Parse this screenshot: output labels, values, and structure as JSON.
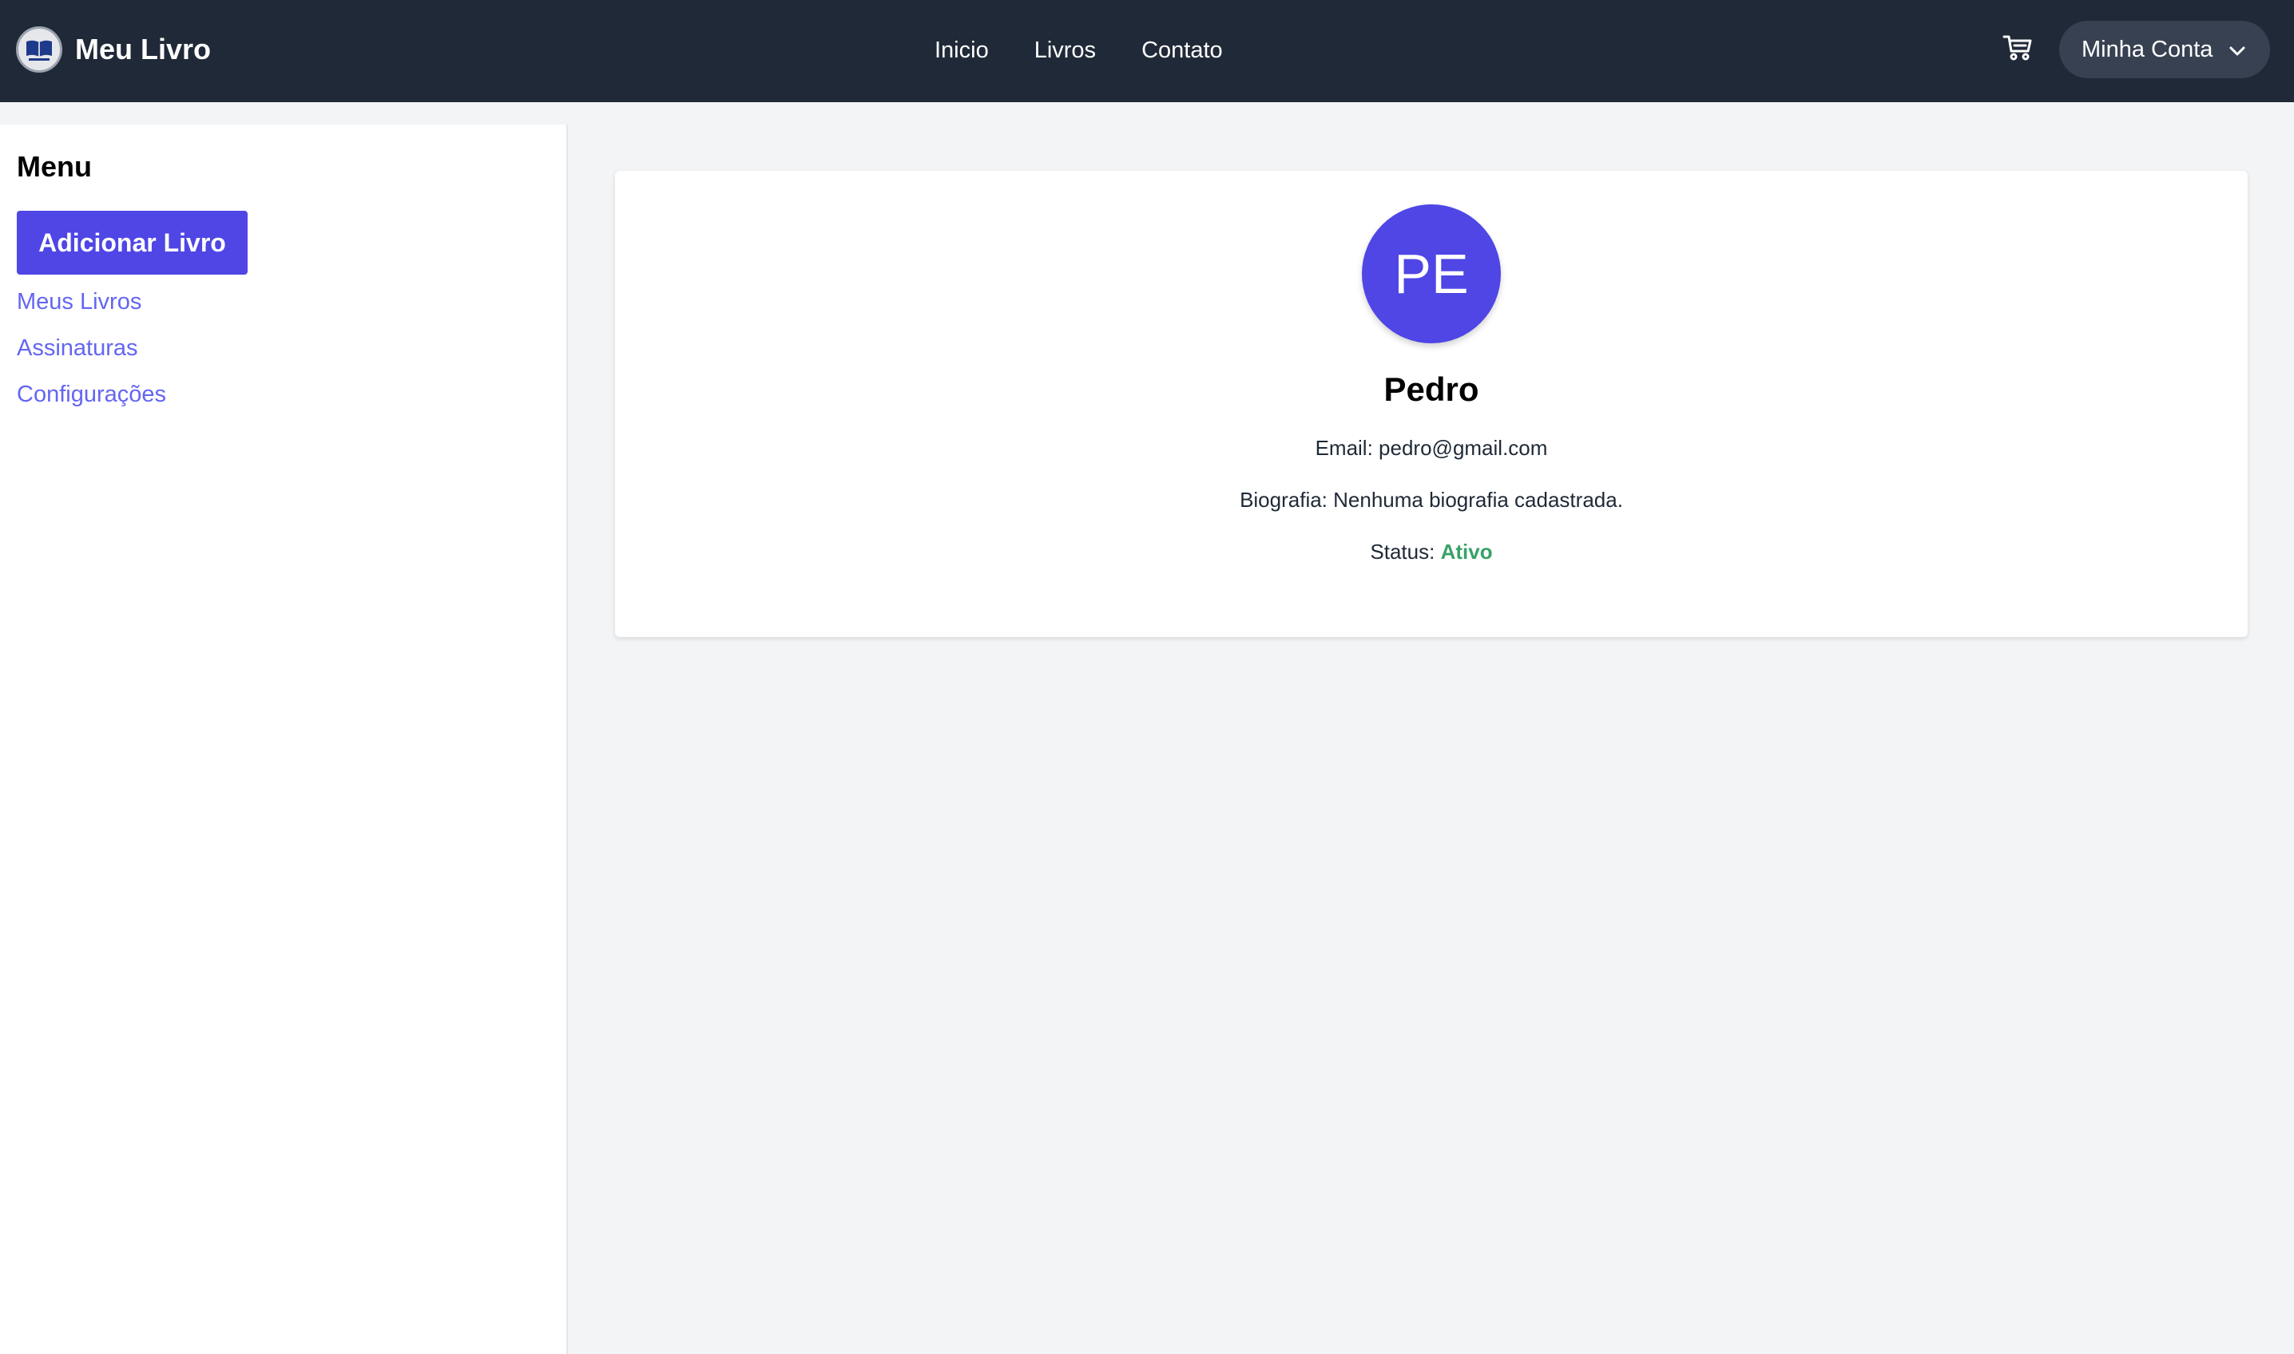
{
  "header": {
    "brand": "Meu Livro",
    "nav": [
      "Inicio",
      "Livros",
      "Contato"
    ],
    "cart_icon": "cart-icon",
    "account_label": "Minha Conta"
  },
  "sidebar": {
    "title": "Menu",
    "add_button": "Adicionar Livro",
    "links": [
      "Meus Livros",
      "Assinaturas",
      "Configurações"
    ]
  },
  "profile": {
    "initials": "PE",
    "name": "Pedro",
    "email_label": "Email:",
    "email": "pedro@gmail.com",
    "bio_label": "Biografia:",
    "bio": "Nenhuma biografia cadastrada.",
    "status_label": "Status:",
    "status": "Ativo"
  },
  "colors": {
    "header_bg": "#1f2937",
    "accent": "#4f46e5",
    "link": "#6366f1",
    "status_active": "#38a169"
  }
}
